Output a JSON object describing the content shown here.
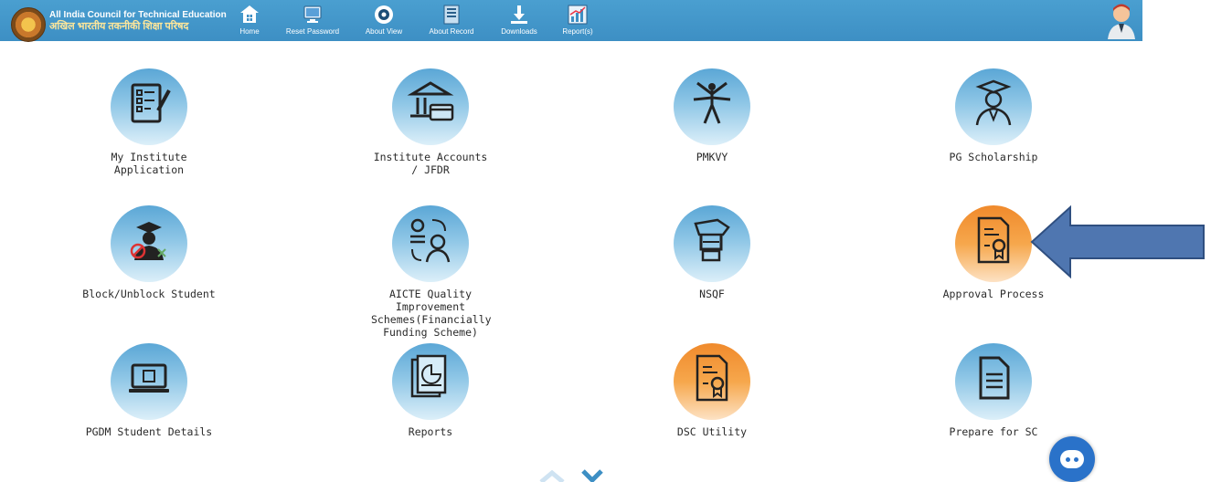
{
  "header": {
    "org_name_en": "All India Council for Technical Education",
    "org_name_hi": "अखिल भारतीय तकनीकी शिक्षा परिषद",
    "nav": [
      {
        "label": "Home",
        "icon": "home-icon"
      },
      {
        "label": "Reset Password",
        "icon": "monitor-icon"
      },
      {
        "label": "About View",
        "icon": "eye-icon"
      },
      {
        "label": "About Record",
        "icon": "record-icon"
      },
      {
        "label": "Downloads",
        "icon": "download-icon"
      },
      {
        "label": "Report(s)",
        "icon": "chart-icon"
      }
    ],
    "user_icon": "user-avatar-icon"
  },
  "tiles": [
    {
      "label": "My Institute Application",
      "icon": "application-checklist-icon",
      "color": "blue"
    },
    {
      "label": "Institute Accounts / JFDR",
      "icon": "bank-card-icon",
      "color": "blue"
    },
    {
      "label": "PMKVY",
      "icon": "people-cheer-icon",
      "color": "blue"
    },
    {
      "label": "PG Scholarship",
      "icon": "graduate-icon",
      "color": "blue"
    },
    {
      "label": "Block/Unblock Student",
      "icon": "blocked-student-icon",
      "color": "blue"
    },
    {
      "label": "AICTE Quality Improvement Schemes(Financially Funding Scheme)",
      "icon": "quality-scheme-icon",
      "color": "blue"
    },
    {
      "label": "NSQF",
      "icon": "skill-hand-icon",
      "color": "blue"
    },
    {
      "label": "Approval Process",
      "icon": "certificate-icon",
      "color": "orange"
    },
    {
      "label": "PGDM Student Details",
      "icon": "laptop-icon",
      "color": "blue"
    },
    {
      "label": "Reports",
      "icon": "report-document-icon",
      "color": "blue"
    },
    {
      "label": "DSC Utility",
      "icon": "certificate-icon",
      "color": "orange"
    },
    {
      "label": "Prepare for SC",
      "icon": "document-icon",
      "color": "blue"
    }
  ],
  "colors": {
    "topbar": "#4598cb",
    "tile_blue": "#5ba7d6",
    "tile_orange": "#f08a2c",
    "pointer_arrow": "#4f76b0"
  }
}
